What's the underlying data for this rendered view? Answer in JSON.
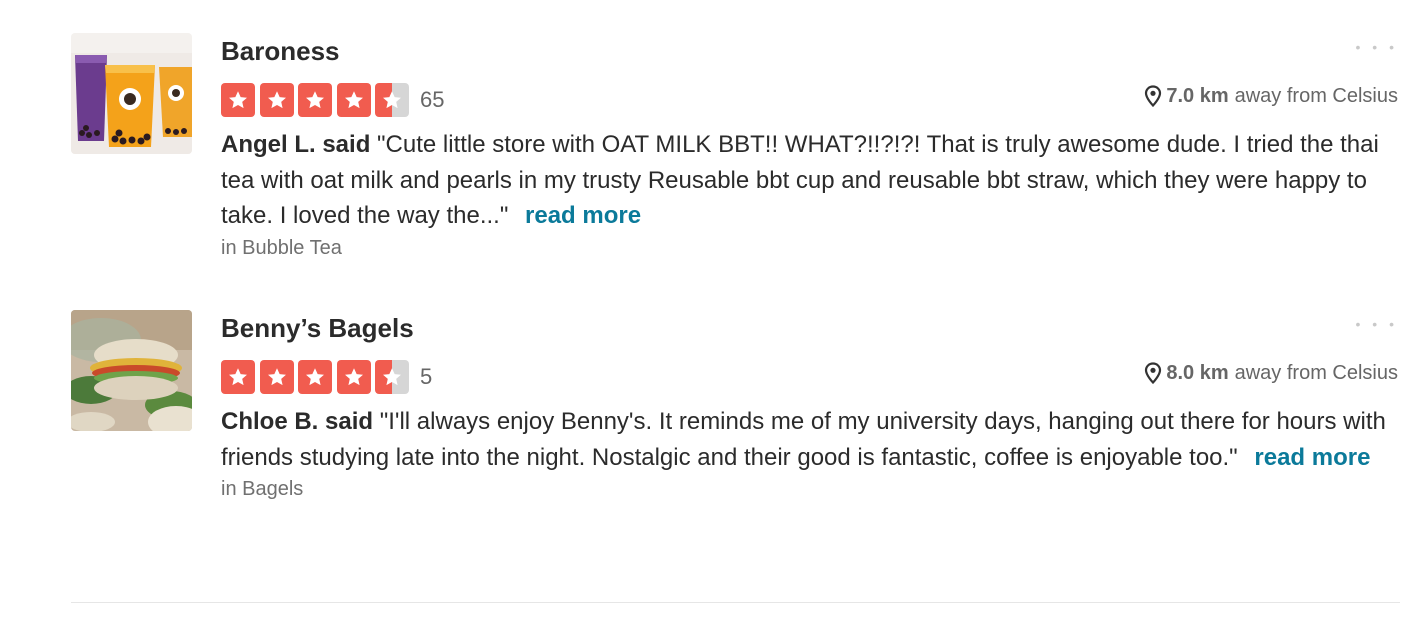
{
  "businesses": [
    {
      "name": "Baroness",
      "rating": 4.5,
      "review_count": "65",
      "distance_value": "7.0 km",
      "distance_suffix": "away from Celsius",
      "review_author": "Angel L. said",
      "review_text": "\"Cute little store with OAT MILK BBT!! WHAT?!!?!?! That is truly awesome dude. I tried the thai tea with oat milk and pearls in my trusty Reusable bbt cup and reusable bbt straw, which they were happy to take. I loved the way the...\"",
      "read_more": "read more",
      "category": "in Bubble Tea",
      "more_label": "• • •",
      "thumb_icon": "bubble-tea-photo"
    },
    {
      "name": "Benny’s Bagels",
      "rating": 4.5,
      "review_count": "5",
      "distance_value": "8.0 km",
      "distance_suffix": "away from Celsius",
      "review_author": "Chloe B. said",
      "review_text": "\"I'll always enjoy Benny's. It reminds me of my university days, hanging out there for hours with friends studying late into the night. Nostalgic and their good is fantastic, coffee is enjoyable too.\"",
      "read_more": "read more",
      "category": "in Bagels",
      "more_label": "• • •",
      "thumb_icon": "bagel-sandwich-photo"
    }
  ],
  "colors": {
    "star_red": "#f15c4f",
    "star_empty": "#d6d6d6",
    "link_blue": "#0b7a9a"
  }
}
